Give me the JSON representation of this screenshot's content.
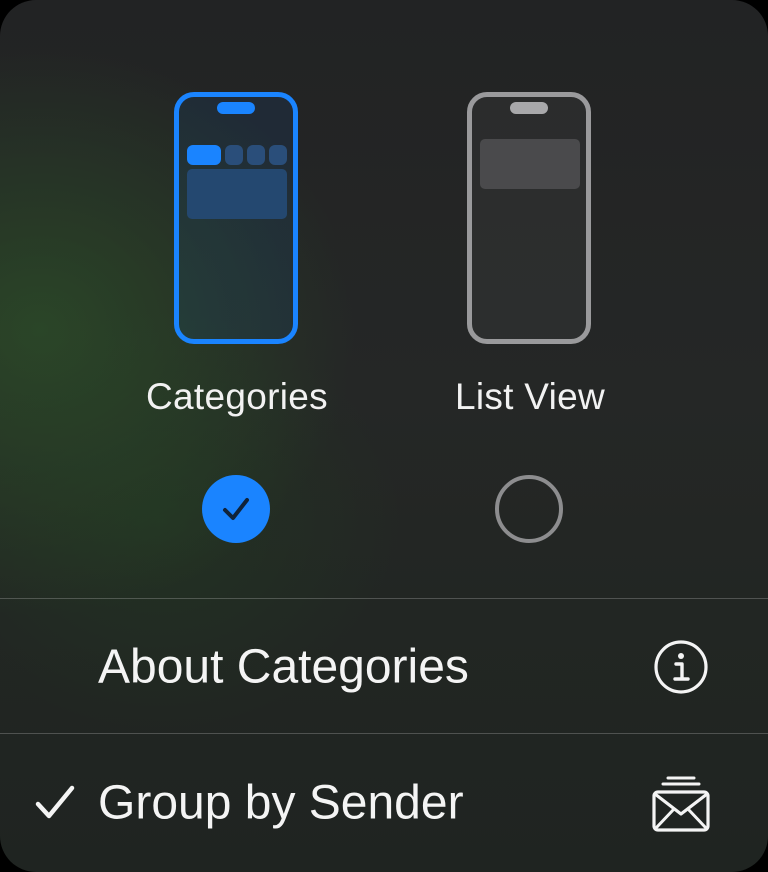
{
  "view_options": [
    {
      "label": "Categories",
      "selected": true
    },
    {
      "label": "List View",
      "selected": false
    }
  ],
  "menu_items": [
    {
      "label": "About Categories",
      "icon": "info-circle-icon",
      "checked": false
    },
    {
      "label": "Group by Sender",
      "icon": "stacked-envelopes-icon",
      "checked": true
    }
  ],
  "colors": {
    "accent": "#1a84ff",
    "text": "#f4f4f4",
    "unselected_outline": "#9a9a9c"
  }
}
